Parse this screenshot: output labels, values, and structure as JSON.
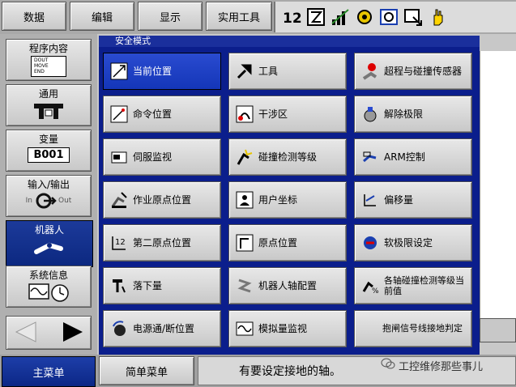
{
  "top_menu": {
    "items": [
      "数据",
      "编辑",
      "显示",
      "实用工具"
    ],
    "icons": [
      "axis-12-icon",
      "edit-box-icon",
      "signal-bars-icon",
      "ring-icon",
      "robot-w-icon",
      "screen-arrow-icon",
      "hand-icon"
    ]
  },
  "left_menu": {
    "items": [
      {
        "label": "程序内容",
        "sub_lines": [
          "DOUT",
          "MOVE",
          "END"
        ]
      },
      {
        "label": "通用"
      },
      {
        "label": "变量",
        "value": "B001"
      },
      {
        "label": "输入/输出",
        "sub_in": "In",
        "sub_out": "Out"
      },
      {
        "label": "机器人"
      },
      {
        "label": "系统信息"
      }
    ]
  },
  "main": {
    "title": "安全模式",
    "buttons": [
      [
        "当前位置",
        "工具",
        "超程与碰撞传感器"
      ],
      [
        "命令位置",
        "干涉区",
        "解除极限"
      ],
      [
        "伺服监视",
        "碰撞检测等级",
        "ARM控制"
      ],
      [
        "作业原点位置",
        "用户坐标",
        "偏移量"
      ],
      [
        "第二原点位置",
        "原点位置",
        "软极限设定"
      ],
      [
        "落下量",
        "机器人轴配置",
        "各轴碰撞检测等级当前值"
      ],
      [
        "电源通/断位置",
        "模拟量监视",
        "抱闸信号线接地判定"
      ]
    ]
  },
  "bottom": {
    "main_menu": "主菜单",
    "simple_menu": "简单菜单",
    "status": "有要设定接地的轴。",
    "watermark": "工控维修那些事儿"
  },
  "colors": {
    "selected": "#1436b8",
    "panel": "#0b1e8c"
  }
}
